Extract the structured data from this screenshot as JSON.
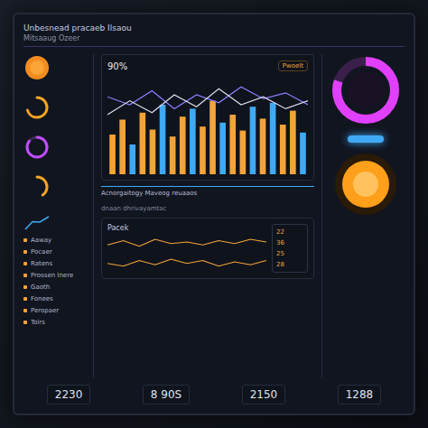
{
  "header": {
    "title": "Unbesnead pracaeb Ilsaou",
    "subtitle": "Mitsaaug Ozeer"
  },
  "sidebar": {
    "widgets": [
      {
        "kind": "disc",
        "color": "#f28c1e",
        "level": 1
      },
      {
        "kind": "arc",
        "color": "#f5a623",
        "level": 0.7
      },
      {
        "kind": "ring",
        "color": "#c04dff",
        "level": 0.85
      },
      {
        "kind": "arc",
        "color": "#f5a623",
        "level": 0.4
      },
      {
        "kind": "spark",
        "color": "#3fa9f5",
        "level": 0.6
      }
    ],
    "labels": [
      "Aaway",
      "Pocaer",
      "Ratens",
      "Prossen Inere",
      "Gaoth",
      "Fonees",
      "Peropaer",
      "Tolrs"
    ]
  },
  "chart": {
    "title": "90%",
    "badge": "Pwoelt",
    "bars": [
      {
        "value": 40,
        "color": "#f2a33a"
      },
      {
        "value": 55,
        "color": "#f2a33a"
      },
      {
        "value": 30,
        "color": "#3fa9f5"
      },
      {
        "value": 62,
        "color": "#f2a33a"
      },
      {
        "value": 45,
        "color": "#f2a33a"
      },
      {
        "value": 70,
        "color": "#3fa9f5"
      },
      {
        "value": 38,
        "color": "#f2a33a"
      },
      {
        "value": 58,
        "color": "#f2a33a"
      },
      {
        "value": 66,
        "color": "#3fa9f5"
      },
      {
        "value": 48,
        "color": "#f2a33a"
      },
      {
        "value": 74,
        "color": "#f2a33a"
      },
      {
        "value": 52,
        "color": "#3fa9f5"
      },
      {
        "value": 60,
        "color": "#f2a33a"
      },
      {
        "value": 44,
        "color": "#f2a33a"
      },
      {
        "value": 68,
        "color": "#3fa9f5"
      },
      {
        "value": 56,
        "color": "#f2a33a"
      },
      {
        "value": 72,
        "color": "#3fa9f5"
      },
      {
        "value": 50,
        "color": "#f2a33a"
      },
      {
        "value": 64,
        "color": "#f2a33a"
      },
      {
        "value": 42,
        "color": "#3fa9f5"
      }
    ],
    "lines": [
      {
        "color": "#8f7bff",
        "values": [
          78,
          70,
          84,
          66,
          80,
          72,
          88,
          76,
          82,
          70
        ]
      },
      {
        "color": "#d8d8ec",
        "values": [
          60,
          74,
          62,
          80,
          68,
          86,
          70,
          78,
          66,
          74
        ]
      }
    ],
    "caption": "Acnorgaitogy Maveog reuaaos",
    "subcaption": "dnaan dhrivayamtac"
  },
  "panel": {
    "title": "Pacek",
    "sparks": [
      {
        "color": "#f2a33a",
        "values": [
          5,
          8,
          4,
          9,
          6,
          7,
          5,
          8,
          6,
          9,
          7
        ]
      },
      {
        "color": "#f2a33a",
        "values": [
          6,
          4,
          8,
          5,
          9,
          6,
          8,
          4,
          7,
          5,
          8
        ]
      }
    ],
    "values": [
      "22",
      "36",
      "25",
      "28"
    ]
  },
  "gauges": {
    "ring": {
      "color": "#e040fb",
      "level": 0.8
    },
    "pill": {
      "color": "#3fa9f5"
    },
    "orb": {
      "color": "#ff9f1a"
    }
  },
  "footer": [
    "2230",
    "8 90S",
    "2150",
    "1288"
  ]
}
